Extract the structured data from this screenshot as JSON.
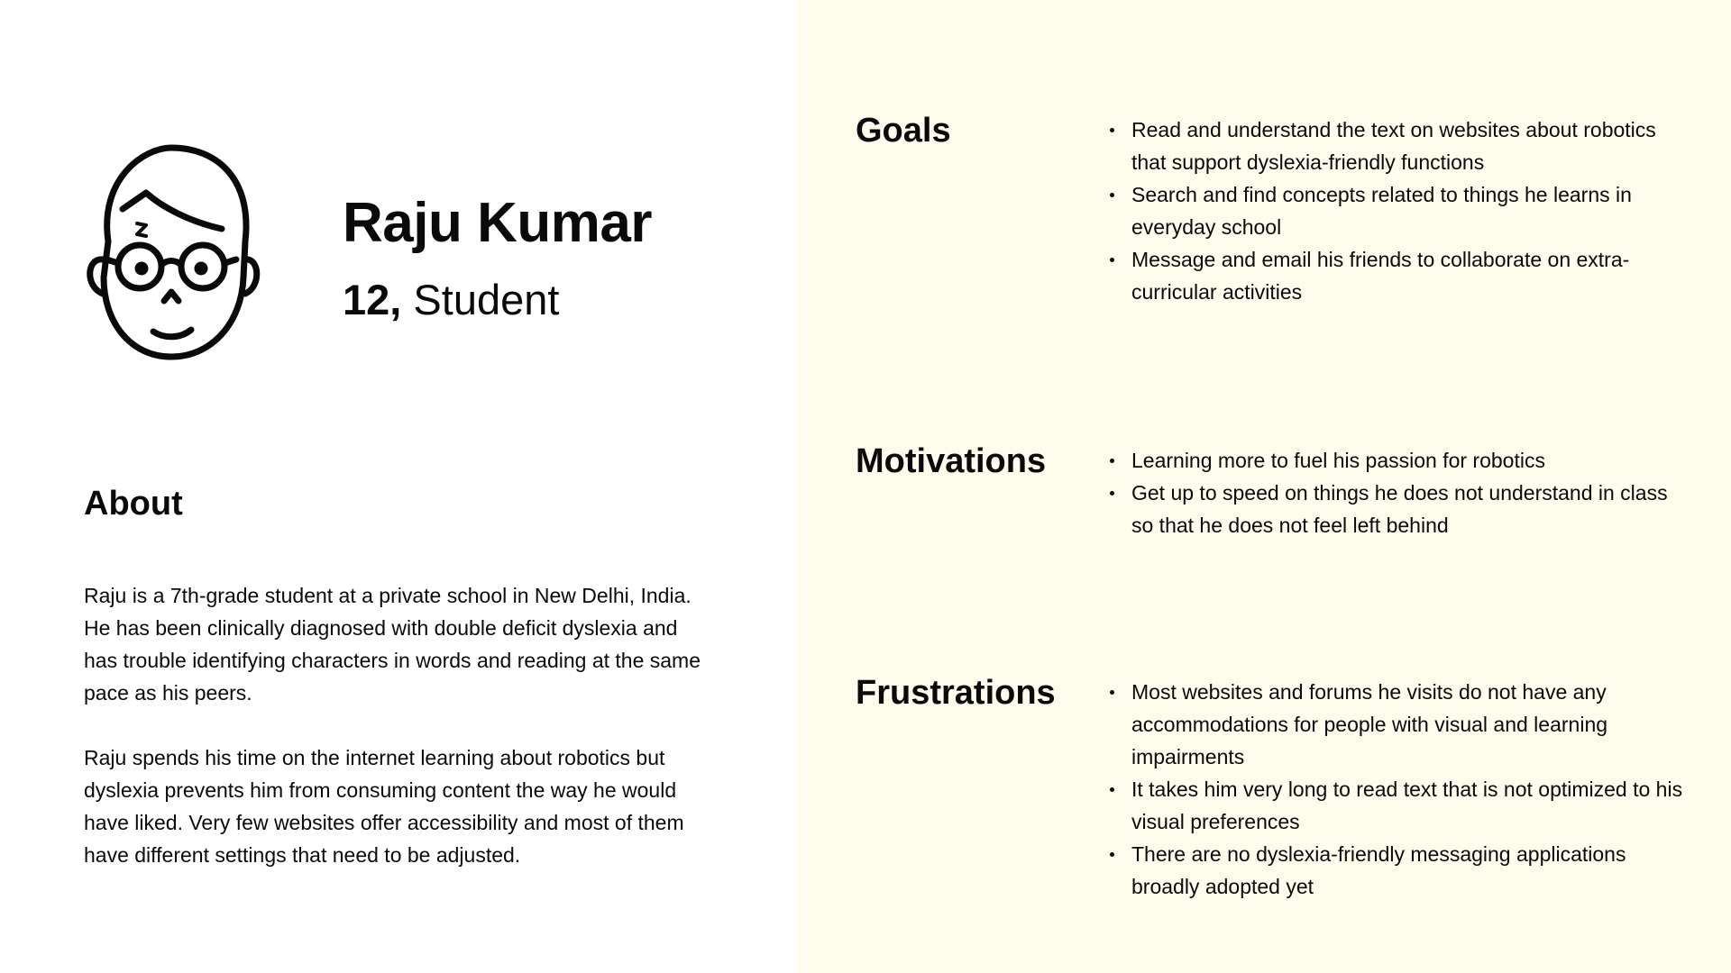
{
  "persona": {
    "name": "Raju Kumar",
    "age": "12,",
    "role": "Student",
    "avatar_icon": "boy-with-glasses-icon"
  },
  "about": {
    "heading": "About",
    "paragraphs": [
      "Raju is a 7th-grade student at a private school in New Delhi, India. He has been clinically diagnosed with double deficit dyslexia and has trouble identifying characters in words and reading at the same pace as his peers.",
      "Raju spends his time on the internet learning about robotics but dyslexia prevents him from consuming content the way he would have liked. Very few websites offer accessibility and most of them have different settings that need to be adjusted."
    ]
  },
  "goals": {
    "heading": "Goals",
    "items": [
      "Read and understand the text on websites about robotics that support dyslexia-friendly functions",
      "Search and find concepts related to things he learns in everyday school",
      "Message and email his friends to collaborate on extra-curricular activities"
    ]
  },
  "motivations": {
    "heading": "Motivations",
    "items": [
      "Learning more to fuel his passion for robotics",
      "Get up to speed on things he does not understand in class so that he does not feel left behind"
    ]
  },
  "frustrations": {
    "heading": "Frustrations",
    "items": [
      "Most websites and forums he visits do not have any accommodations for people with visual and learning impairments",
      "It takes him very long to read text that is not optimized to his visual preferences",
      "There are no dyslexia-friendly messaging applications broadly adopted yet"
    ]
  },
  "colors": {
    "right_panel_bg": "#fdfced",
    "text": "#0a0a0a"
  }
}
